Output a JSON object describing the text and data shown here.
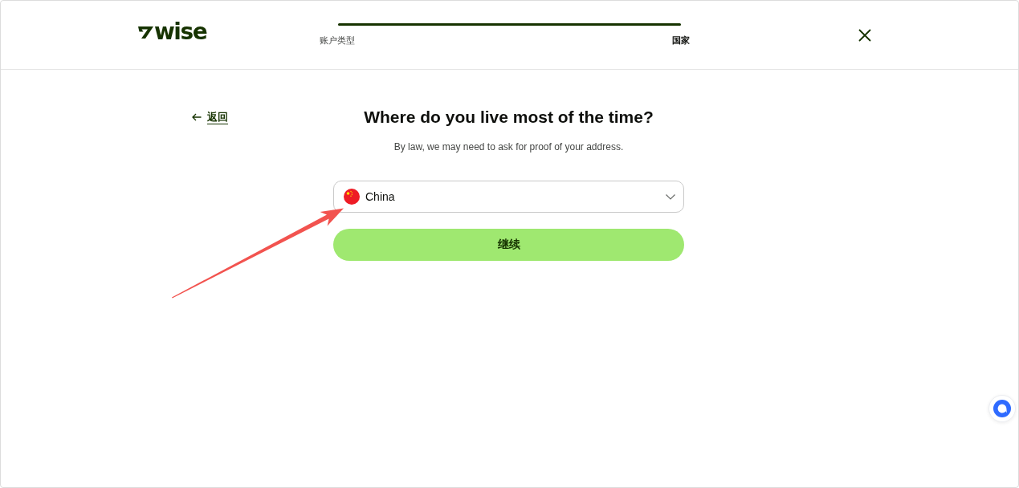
{
  "header": {
    "logo": {
      "text": "wise"
    },
    "progress": {
      "level": 1,
      "steps": [
        {
          "label": "账户类型",
          "selected": false
        },
        {
          "label": "国家",
          "selected": true
        }
      ]
    }
  },
  "back_link": {
    "label": "返回"
  },
  "title": "Where do you live most of the time?",
  "subtitle": "By law, we may need to ask for proof of your address.",
  "country_select": {
    "value": "China"
  },
  "continue_button": {
    "label": "继续"
  }
}
